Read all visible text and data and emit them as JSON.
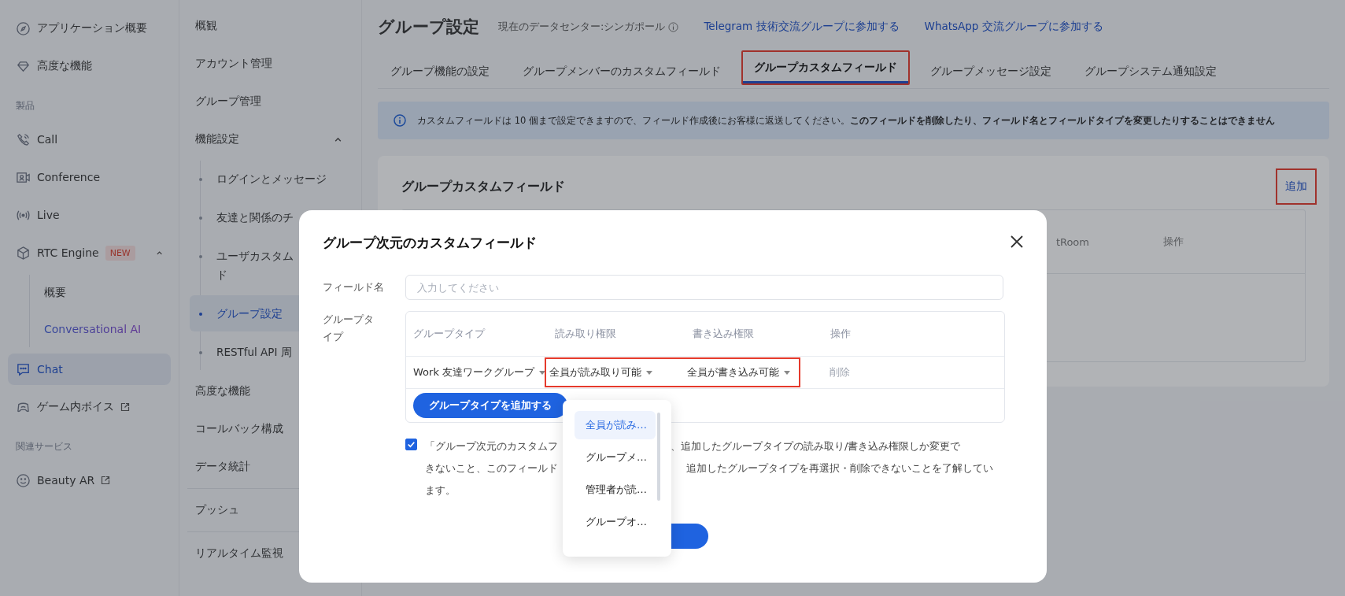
{
  "sidebar": {
    "items": [
      {
        "kind": "item",
        "label": "アプリケーション概要",
        "selected": false
      },
      {
        "kind": "item",
        "label": "高度な機能",
        "selected": false
      },
      {
        "kind": "section",
        "label": "製品"
      },
      {
        "kind": "item",
        "label": "Call",
        "selected": false
      },
      {
        "kind": "item",
        "label": "Conference",
        "selected": false
      },
      {
        "kind": "item",
        "label": "Live",
        "selected": false
      },
      {
        "kind": "item",
        "label": "RTC Engine",
        "badge": "NEW",
        "expanded": true,
        "selected": false,
        "children": [
          {
            "label": "概要",
            "selected": false,
            "accent": false
          },
          {
            "label": "Conversational AI",
            "selected": false,
            "accent": true
          }
        ]
      },
      {
        "kind": "item",
        "label": "Chat",
        "selected": true
      },
      {
        "kind": "item",
        "label": "ゲーム内ボイス",
        "external": true,
        "selected": false
      },
      {
        "kind": "section",
        "label": "関連サービス"
      },
      {
        "kind": "item",
        "label": "Beauty AR",
        "external": true,
        "selected": false
      }
    ]
  },
  "subnav": {
    "items": [
      {
        "label": "概観",
        "selected": false
      },
      {
        "label": "アカウント管理",
        "selected": false
      },
      {
        "label": "グループ管理",
        "selected": false
      },
      {
        "label": "機能設定",
        "expanded": true,
        "selected": false,
        "children": [
          {
            "lines": [
              "ログインとメッセージ"
            ],
            "selected": false
          },
          {
            "lines": [
              "友達と関係のチ"
            ],
            "selected": false
          },
          {
            "lines": [
              "ユーザカスタム",
              "ド"
            ],
            "selected": false
          },
          {
            "lines": [
              "グループ設定"
            ],
            "selected": true
          },
          {
            "lines": [
              "RESTful API 周"
            ],
            "selected": false
          }
        ]
      },
      {
        "label": "高度な機能",
        "selected": false
      },
      {
        "label": "コールバック構成",
        "selected": false
      },
      {
        "label": "データ統計",
        "selected": false,
        "divider_after": true
      },
      {
        "label": "プッシュ",
        "selected": false,
        "divider_after": true
      },
      {
        "label": "リアルタイム監視",
        "selected": false
      }
    ]
  },
  "header": {
    "title": "グループ設定",
    "datacenter": "現在のデータセンター:シンガポール",
    "links": [
      "Telegram 技術交流グループに参加する",
      "WhatsApp 交流グループに参加する"
    ]
  },
  "tabs": [
    {
      "label": "グループ機能の設定",
      "selected": false,
      "highlighted": false
    },
    {
      "label": "グループメンバーのカスタムフィールド",
      "selected": false,
      "highlighted": false
    },
    {
      "label": "グループカスタムフィールド",
      "selected": true,
      "highlighted": true
    },
    {
      "label": "グループメッセージ設定",
      "selected": false,
      "highlighted": false
    },
    {
      "label": "グループシステム通知設定",
      "selected": false,
      "highlighted": false
    }
  ],
  "notice": "カスタムフィールドは 10 個まで設定できますので、フィールド作成後にお客様に返送してください。**このフィールドを削除したり、フィールド名とフィールドタイプを変更したりすることはできません**",
  "card": {
    "title": "グループカスタムフィールド",
    "add_link": {
      "label": "追加",
      "highlighted": true
    },
    "table_headers": [
      "tRoom",
      "操作"
    ]
  },
  "modal": {
    "title": "グループ次元のカスタムフィールド",
    "field_name": {
      "label": "フィールド名",
      "placeholder": "入力してください"
    },
    "group_type": {
      "label": "グループタイプ",
      "columns": [
        "グループタイプ",
        "読み取り権限",
        "書き込み権限",
        "操作"
      ],
      "rows": [
        {
          "type": "Work 友達ワークグループ",
          "read": "全員が読み取り可能",
          "write": "全員が書き込み可能",
          "action": "削除",
          "highlighted": true
        }
      ],
      "add_button": "グループタイプを追加する"
    },
    "agreement": {
      "checked": true,
      "lines": [
        [
          "「グループ次元のカスタムフ",
          "、追加したグループタイプの読み取り/書き込み権限しか変更で"
        ],
        [
          "きないこと、このフィールド",
          "追加したグループタイプを再選択・削除できないことを了解してい"
        ],
        [
          "ます。"
        ]
      ]
    },
    "dropdown": {
      "options": [
        {
          "label": "全員が読み…",
          "selected": true
        },
        {
          "label": "グループメ…",
          "selected": false
        },
        {
          "label": "管理者が読…",
          "selected": false
        },
        {
          "label": "グループオ…",
          "selected": false
        }
      ]
    }
  }
}
